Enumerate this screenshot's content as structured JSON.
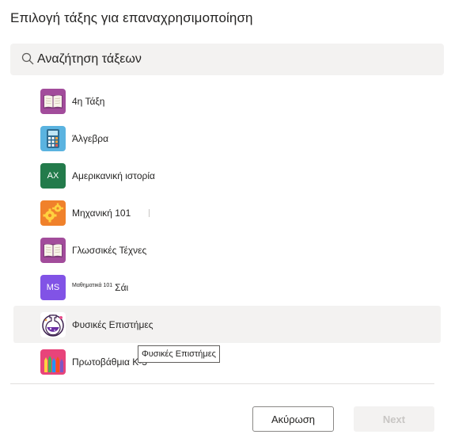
{
  "dialog": {
    "title": "Επιλογή τάξης για επαναχρησιμοποίηση"
  },
  "search": {
    "placeholder": "Αναζήτηση τάξεων",
    "icon": "search-icon"
  },
  "classes": [
    {
      "name": "4η Τάξη",
      "icon": "book-icon",
      "tile_color": "#a24c9b"
    },
    {
      "name": "Άλγεβρα",
      "icon": "calculator-icon",
      "tile_color": "#5ab3e0"
    },
    {
      "name": "Αμερικανική ιστορία",
      "tile_text": "AX",
      "tile_color": "#237b4b"
    },
    {
      "name": "Μηχανική 101",
      "icon": "gears-icon",
      "tile_color": "#f0812b"
    },
    {
      "name": "Γλωσσικές Τέχνες",
      "icon": "book-icon",
      "tile_color": "#a24c9b"
    },
    {
      "name_prefix": "Μαθηματικά 101",
      "name": "Σάι",
      "tile_text": "MS",
      "tile_color": "#8153e6"
    },
    {
      "name": "Φυσικές Επιστήμες",
      "icon": "flask-icon",
      "tile_color": "#ffffff"
    },
    {
      "name": "Πρωτοβάθμια Κ-3",
      "icon": "pencils-icon",
      "tile_color": "#e8447a"
    }
  ],
  "tooltip": {
    "text": "Φυσικές Επιστήμες"
  },
  "footer": {
    "cancel_label": "Ακύρωση",
    "next_label": "Next"
  }
}
